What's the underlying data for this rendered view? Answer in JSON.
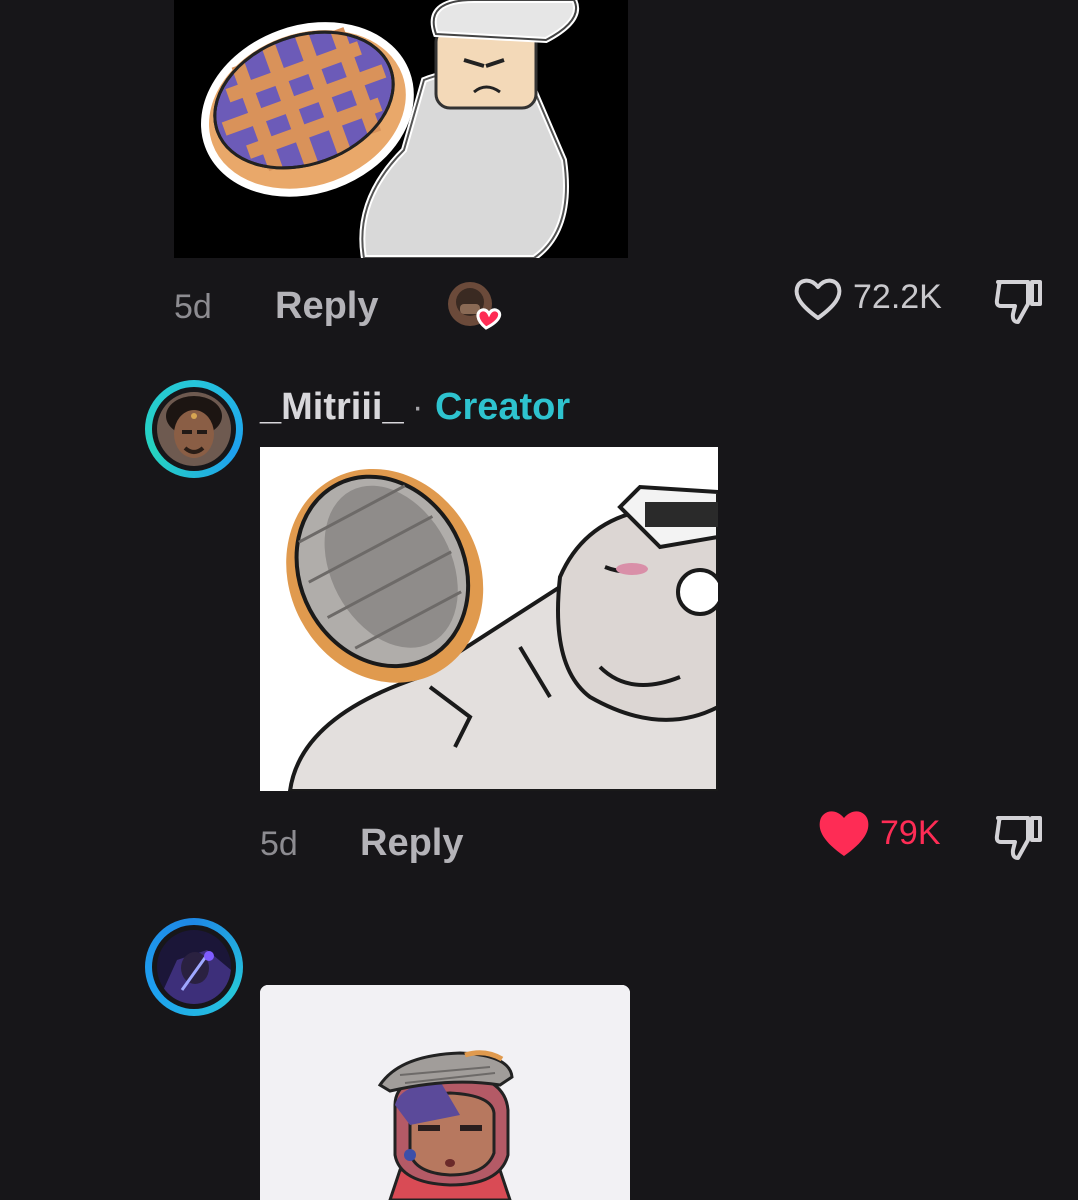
{
  "comments": [
    {
      "time": "5d",
      "reply_label": "Reply",
      "likes": "72.2K",
      "liked": false
    },
    {
      "username": "_Mitriii_",
      "separator": "·",
      "badge": "Creator",
      "time": "5d",
      "reply_label": "Reply",
      "likes": "79K",
      "liked": true
    },
    {
      "username": ""
    }
  ],
  "colors": {
    "background": "#171619",
    "like_active": "#fe2c55",
    "creator_badge": "#2ec3cf",
    "avatar_ring": "#26c6da"
  },
  "icons": [
    "heart-outline-icon",
    "heart-filled-icon",
    "dislike-icon",
    "creator-liked-badge-icon"
  ]
}
